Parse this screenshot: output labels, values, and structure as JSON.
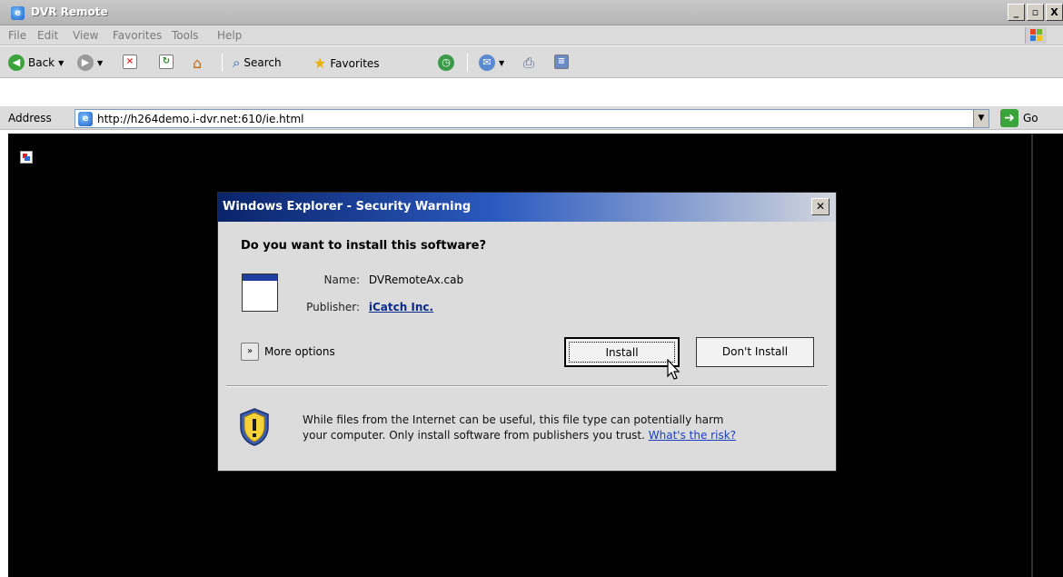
{
  "window": {
    "title": "DVR Remote",
    "buttons": {
      "minimize": "_",
      "maximize": "▫",
      "close": "X"
    }
  },
  "menu": {
    "items": [
      "File",
      "Edit",
      "View",
      "Favorites",
      "Tools",
      "Help"
    ]
  },
  "toolbar": {
    "back_label": "Back",
    "search_label": "Search",
    "favorites_label": "Favorites"
  },
  "address": {
    "label": "Address",
    "url": "http://h264demo.i-dvr.net:610/ie.html",
    "go_label": "Go"
  },
  "dialog": {
    "title": "Windows Explorer - Security Warning",
    "question": "Do you want to install this software?",
    "name_label": "Name:",
    "name_value": "DVRemoteAx.cab",
    "publisher_label": "Publisher:",
    "publisher_value": "iCatch Inc.",
    "more_options": "More options",
    "install_button": "Install",
    "dont_install_button": "Don't Install",
    "warning_line1": "While files from the Internet can be useful, this file type can potentially harm",
    "warning_line2": "your computer. Only install software from publishers you trust.",
    "risk_link": "What's the risk?"
  },
  "colors": {
    "title_gradient_start": "#0a246a",
    "content_background": "#000000",
    "link": "#1a3ec0"
  }
}
